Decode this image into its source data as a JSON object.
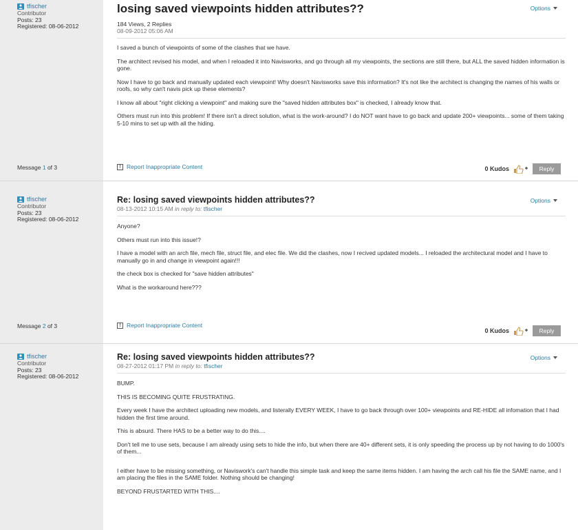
{
  "icons": {
    "user": "user-badge-icon",
    "options_caret": "chevron-down-icon",
    "report": "exclamation-box-icon",
    "kudo": "thumbs-up-plus-icon"
  },
  "colors": {
    "link": "#2a7ca3",
    "sidebar_bg": "#ececec",
    "reply_button": "#9a9a9a"
  },
  "posts": [
    {
      "author": "tfischer",
      "rank": "Contributor",
      "posts_label": "Posts: 23",
      "registered": "Registered: 08-06-2012",
      "title": "losing saved viewpoints hidden attributes??",
      "views": "184 Views, 2 Replies",
      "date": "08-09-2012 05:06 AM",
      "options": "Options",
      "paragraphs": [
        "I saved a bunch of viewpoints of some of the clashes that we have.",
        "The architect revised his model, and when I reloaded it into Navisworks, and go through all my viewpoints, the sections are still there, but ALL the saved hidden information is gone.",
        "Now I have to go back and manually updated each viewpoint! Why doesn't Navisworks save this information? It's not like the architect is changing the names of his walls or roofs, so why can't navis pick up these elements?",
        "I know all about \"right clicking a viewpoint\" and making sure the \"saved hidden attributes box\" is checked, I already know that.",
        "Others must run into this problem! If there isn't a direct solution, what is the work-around? I do NOT want have to go back and update 200+ viewpoints... some of them taking 5-10 mins to set up with all the hiding."
      ],
      "message_prefix": "Message ",
      "message_num": "1",
      "message_suffix": " of 3",
      "report": "Report Inappropriate Content",
      "kudos": "0 Kudos",
      "reply": "Reply"
    },
    {
      "author": "tfischer",
      "rank": "Contributor",
      "posts_label": "Posts: 23",
      "registered": "Registered: 08-06-2012",
      "title": "Re: losing saved viewpoints hidden attributes??",
      "date": "08-13-2012 10:15 AM",
      "in_reply_label": "in reply to:",
      "in_reply_user": "tfischer",
      "options": "Options",
      "paragraphs": [
        "Anyone?",
        "Others must run into this issue!?",
        "I have a model with an arch file, mech file, struct file, and elec file. We did the clashes, now I recived updated models... I reloaded the architectural model and I have to manually go in and change in viewpoint again!!!",
        "the check box is checked for \"save hidden attributes\"",
        "What is the workaround here???"
      ],
      "message_prefix": "Message ",
      "message_num": "2",
      "message_suffix": " of 3",
      "report": "Report Inappropriate Content",
      "kudos": "0 Kudos",
      "reply": "Reply"
    },
    {
      "author": "tfischer",
      "rank": "Contributor",
      "posts_label": "Posts: 23",
      "registered": "Registered: 08-06-2012",
      "title": "Re: losing saved viewpoints hidden attributes??",
      "date": "08-27-2012 01:17 PM",
      "in_reply_label": "in reply to:",
      "in_reply_user": "tfischer",
      "options": "Options",
      "paragraphs": [
        "BUMP.",
        "THIS IS BECOMING QUITE FRUSTRATING.",
        "Every week I have the architect uploading new models, and listerally EVERY WEEK, I have to go back through over 100+ viewpoints and RE-HIDE all infomation that I had hidden the first time around.",
        "This is absurd. There HAS to be a better way to do this....",
        "Don't tell me to use sets, because I am already using sets to hide the info, but when there are 40+ different sets, it is only speeding the process up by not having to do 1000's of them...",
        "I either have to be missing something, or Naviswork's can't handle this simple task and keep the same items hidden. I am having the arch call his file the SAME name, and I am placing the files in the SAME folder. Nothing should be changing!",
        "BEYOND FRUSTARTED WITH THIS...."
      ]
    }
  ]
}
